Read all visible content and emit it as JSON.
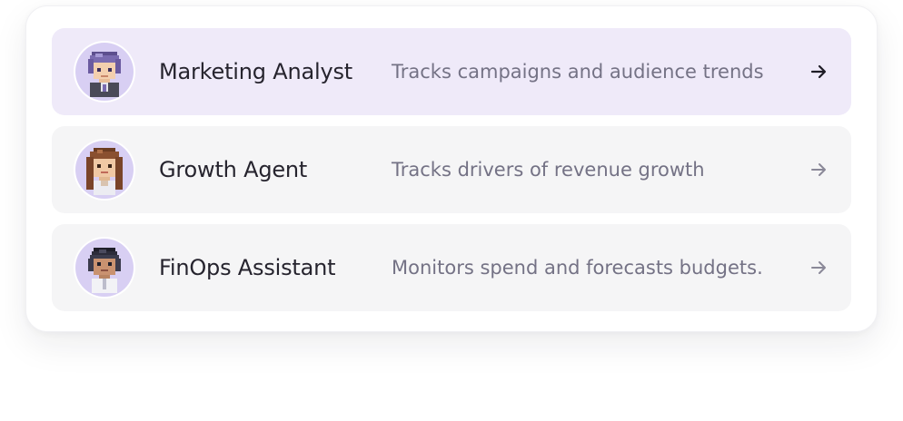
{
  "agents": [
    {
      "name": "Marketing Analyst",
      "description": "Tracks campaigns and audience trends",
      "avatar_icon": "pixel-avatar-purple-hair-icon",
      "active": true
    },
    {
      "name": "Growth Agent",
      "description": "Tracks drivers of revenue growth",
      "avatar_icon": "pixel-avatar-brown-hair-icon",
      "active": false
    },
    {
      "name": "FinOps Assistant",
      "description": "Monitors spend and forecasts budgets.",
      "avatar_icon": "pixel-avatar-headset-icon",
      "active": false
    }
  ],
  "colors": {
    "active_row_bg": "#efeaf9",
    "row_bg": "#f5f5f6",
    "avatar_bg": "#d8cff3",
    "title_text": "#26242e",
    "description_text": "#747285",
    "arrow_active": "#1e1c26",
    "arrow_default": "#8a8898"
  }
}
